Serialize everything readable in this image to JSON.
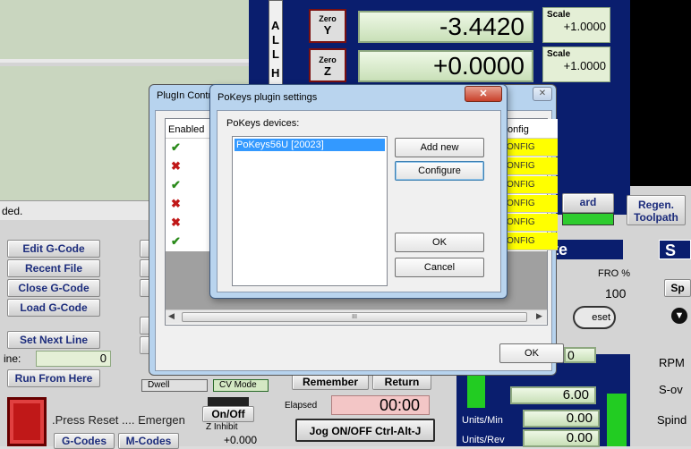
{
  "mach": {
    "zero_y": "Zero",
    "zero_y_axis": "Y",
    "zero_z": "Zero",
    "zero_z_axis": "Z",
    "dro_y": "-3.4420",
    "dro_z": "+0.0000",
    "scale_label": "Scale",
    "scale_y": "+1.0000",
    "scale_z": "+1.0000",
    "vertical_letters": [
      "A",
      "L",
      "L",
      "H"
    ],
    "status_left": "ded.",
    "buttons": {
      "edit_gcode": "Edit G-Code",
      "recent_file": "Recent File",
      "close_gcode": "Close G-Code",
      "load_gcode": "Load G-Code",
      "set_next_line": "Set Next Line",
      "run_from_here": "Run From Here",
      "line_label": "ine:",
      "line_value": "0",
      "regen_toolpath_1": "Regen.",
      "regen_toolpath_2": "Toolpath",
      "remember": "Remember",
      "return": "Return",
      "jog": "Jog ON/OFF Ctrl-Alt-J",
      "gcodes": "G-Codes",
      "mcodes": "M-Codes",
      "onoff": "On/Off",
      "dwell": "Dwell",
      "cv_mode": "CV Mode",
      "reset_partial": "eset",
      "sp_partial": "Sp",
      "ard_partial": "ard"
    },
    "elapsed_label": "Elapsed",
    "elapsed_value": "00:00",
    "press_reset": ".Press Reset .... Emergen",
    "z_inhibit": "Z Inhibit",
    "z_inhibit_value": "+0.000",
    "fro_label": "FRO %",
    "fro_value": "100",
    "feed_value": "6.00",
    "units_min_label": "Units/Min",
    "units_min_value": "0.00",
    "units_rev_label": "Units/Rev",
    "units_rev_value": "0.00",
    "rpm_label": "RPM",
    "sov_label": "S-ov",
    "spind_label": "Spind",
    "te_partial": "te",
    "s_partial": "S",
    "zero_partial": "0",
    "feed_label_partial": "Feedrate"
  },
  "plugin_control": {
    "title": "PlugIn Contr",
    "col_enabled": "Enabled",
    "col_config": "onfig",
    "rows": [
      {
        "enabled": true,
        "config": "ONFIG"
      },
      {
        "enabled": false,
        "config": "ONFIG"
      },
      {
        "enabled": true,
        "config": "ONFIG"
      },
      {
        "enabled": false,
        "config": "ONFIG"
      },
      {
        "enabled": false,
        "config": "ONFIG"
      },
      {
        "enabled": true,
        "config": "ONFIG"
      }
    ],
    "ok": "OK",
    "scroll_mid": "III"
  },
  "pokeys_dialog": {
    "title": "PoKeys plugin settings",
    "devices_label": "PoKeys devices:",
    "devices": [
      "PoKeys56U [20023]"
    ],
    "add_new": "Add new",
    "configure": "Configure",
    "ok": "OK",
    "cancel": "Cancel",
    "close_glyph": "✕"
  },
  "colors": {
    "accent_blue": "#0a1e6e",
    "dro_green": "#d6ebc8",
    "config_yellow": "#ffff00",
    "selection_blue": "#3399ff"
  }
}
